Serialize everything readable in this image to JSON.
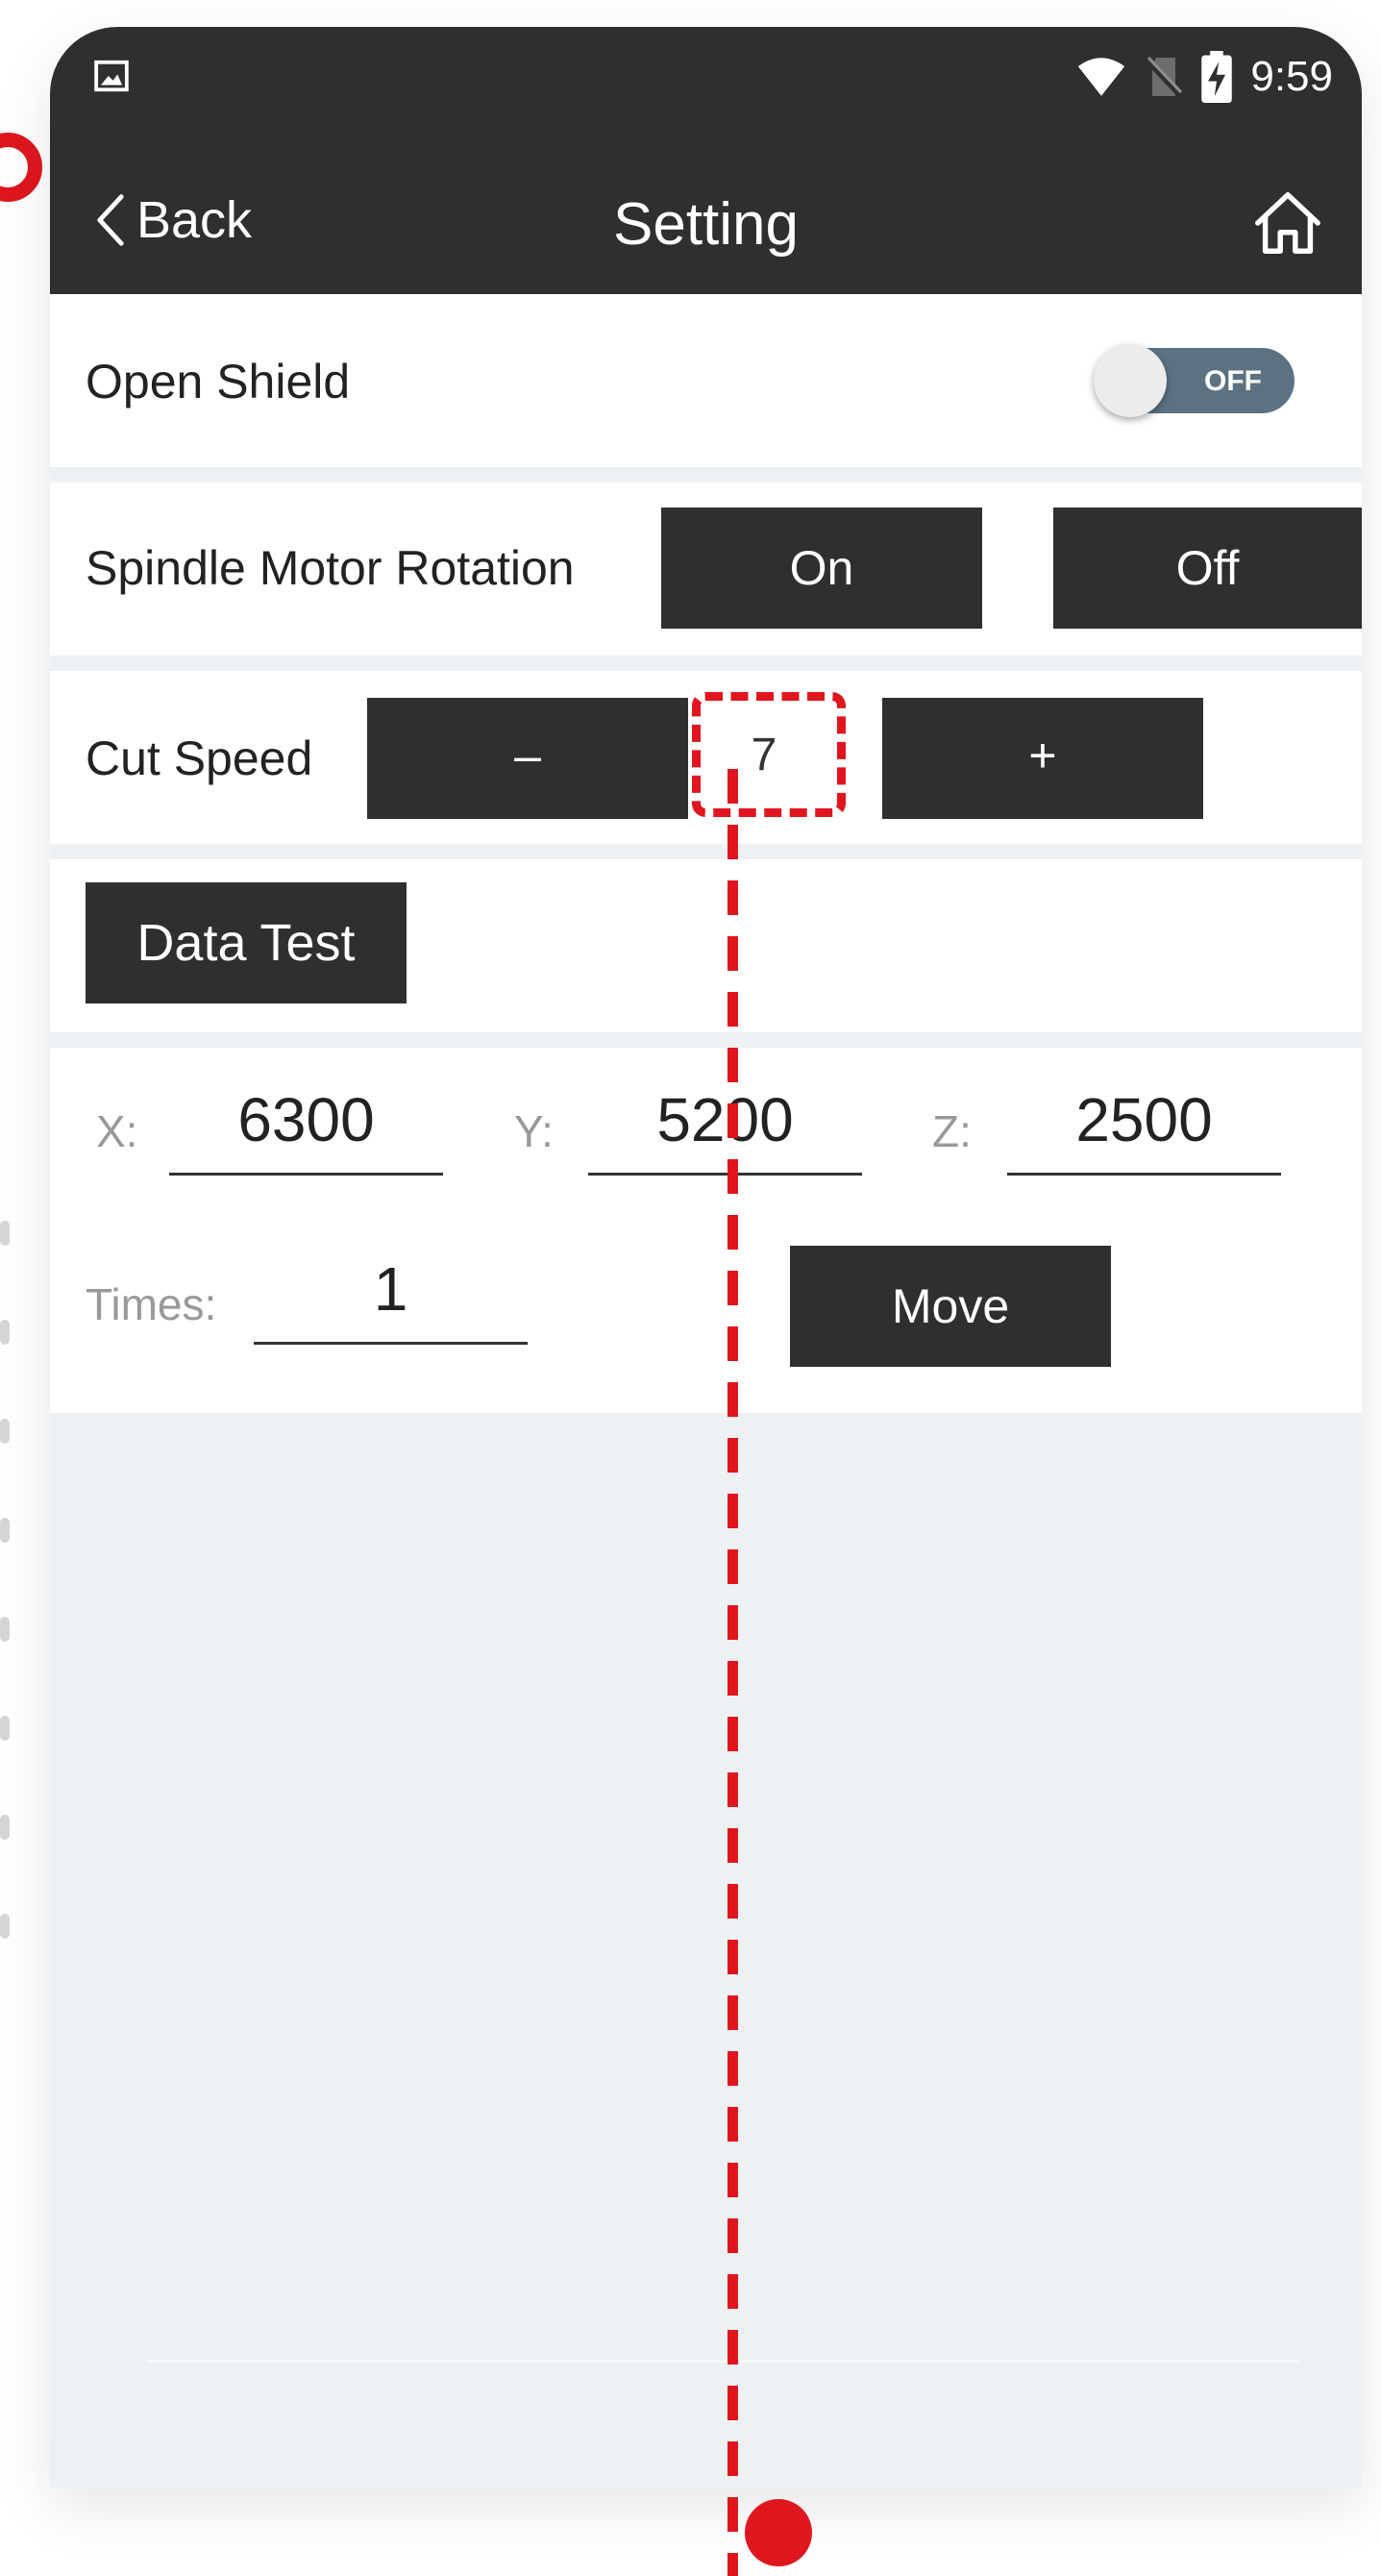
{
  "status_bar": {
    "time": "9:59",
    "icons": [
      "image-icon",
      "wifi-icon",
      "no-sim-icon",
      "battery-charging-icon"
    ]
  },
  "nav": {
    "back_label": "Back",
    "title": "Setting",
    "home_icon": "home-icon"
  },
  "open_shield": {
    "label": "Open Shield",
    "toggle_state": "OFF"
  },
  "spindle": {
    "label": "Spindle Motor Rotation",
    "on_label": "On",
    "off_label": "Off"
  },
  "cut_speed": {
    "label": "Cut Speed",
    "minus_label": "–",
    "value": "7",
    "plus_label": "+"
  },
  "data_test": {
    "label": "Data Test"
  },
  "coordinates": {
    "x_label": "X:",
    "x_value": "6300",
    "y_label": "Y:",
    "y_value": "5200",
    "z_label": "Z:",
    "z_value": "2500"
  },
  "times": {
    "label": "Times:",
    "value": "1",
    "move_label": "Move"
  },
  "colors": {
    "header": "#2d2f30",
    "accent_red": "#e0161e",
    "toggle_off": "#5c7282",
    "background": "#edf1f3"
  }
}
